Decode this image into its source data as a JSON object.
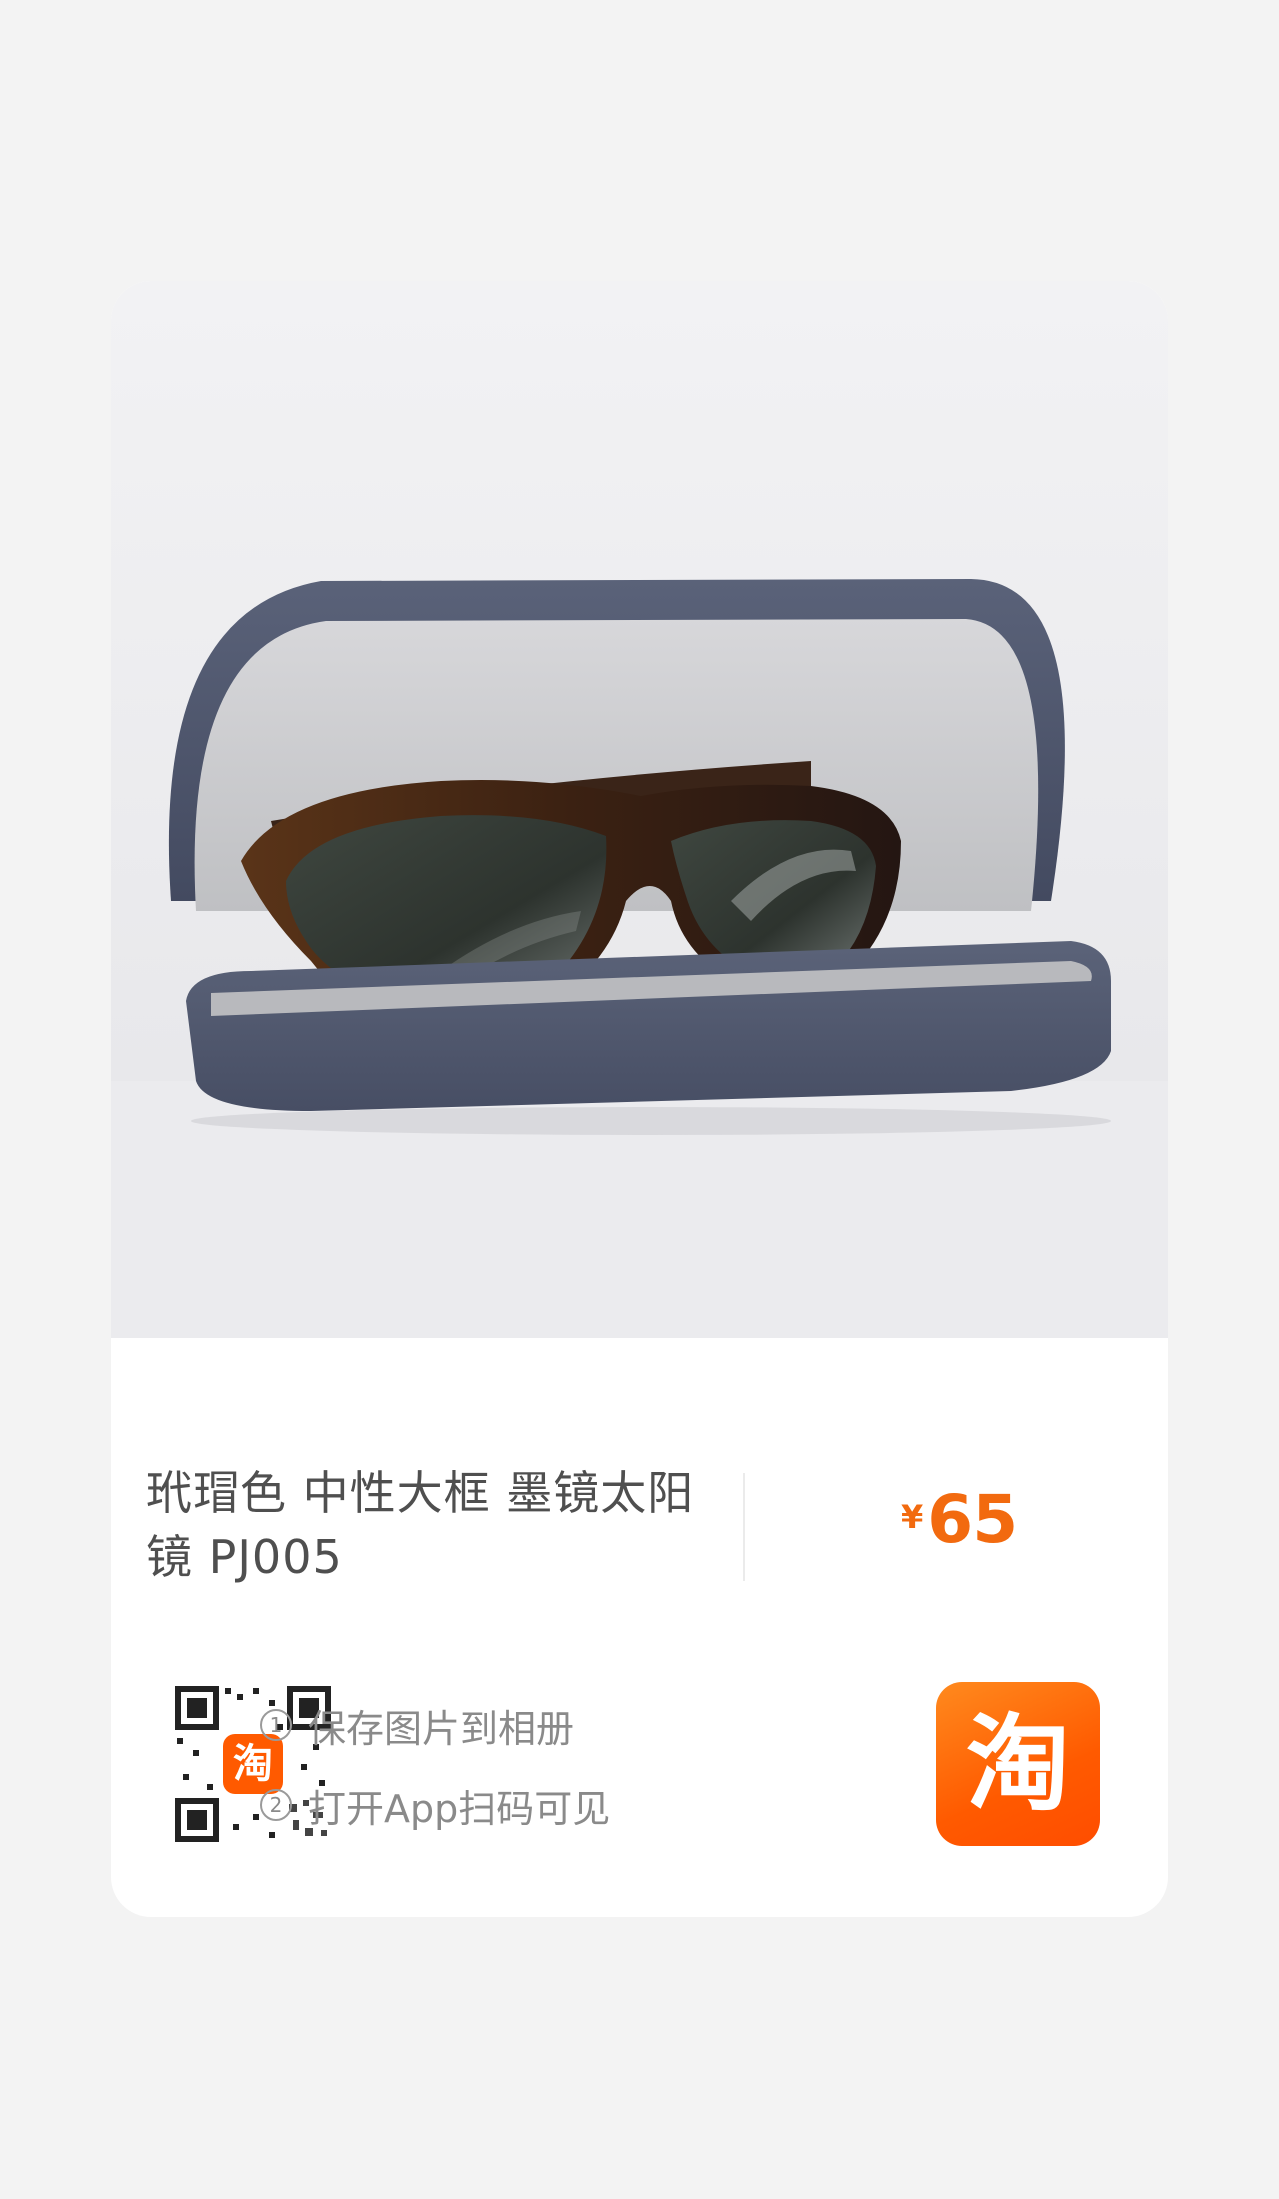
{
  "product": {
    "title": "玳瑁色 中性大框 墨镜太阳镜 PJ005",
    "title_line1": "玳瑁色 中性大框 墨镜太阳",
    "title_line2": "镜 PJ005",
    "currency_symbol": "¥",
    "price": "65",
    "price_color": "#f26a0f"
  },
  "scan_hint": {
    "step1_num": "1",
    "step1_text": "保存图片到相册",
    "step2_num": "2",
    "step2_text": "打开App扫码可见"
  },
  "qr": {
    "center_logo_char": "淘"
  },
  "app": {
    "icon_char": "淘",
    "icon_name": "taobao-app-icon",
    "brand_color": "#ff5a00"
  },
  "image": {
    "subject": "sunglasses-in-case-photo"
  }
}
